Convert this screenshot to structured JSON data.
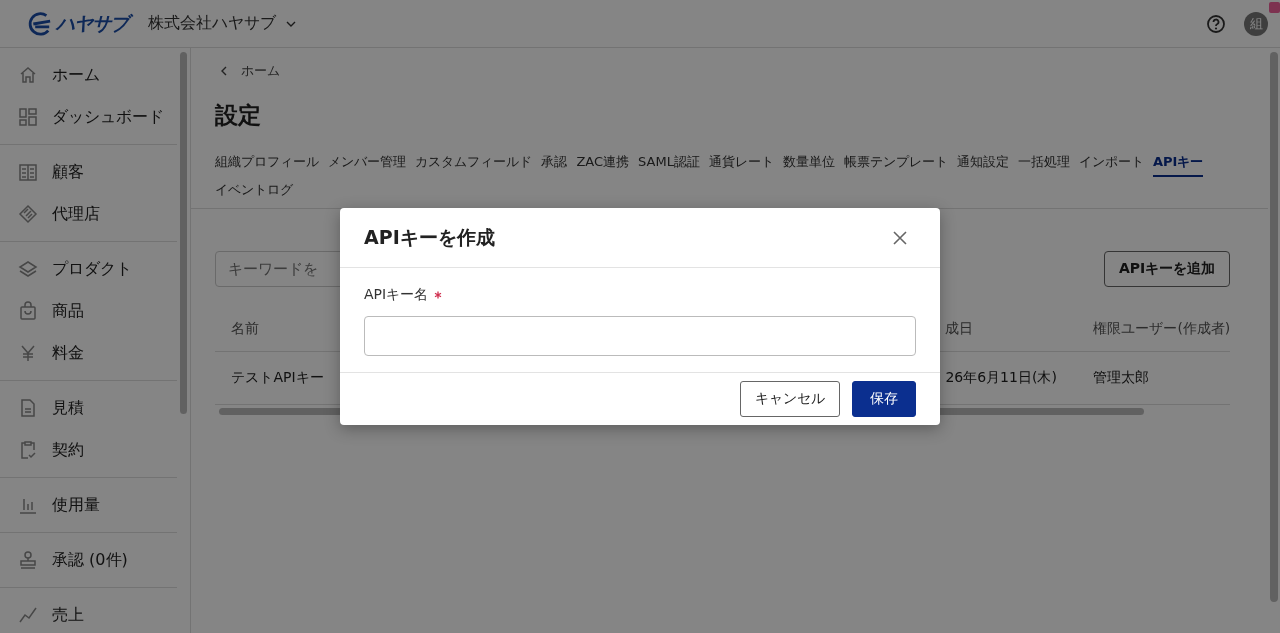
{
  "header": {
    "logo": "ハヤサブ",
    "company": "株式会社ハヤサブ",
    "avatar": "組"
  },
  "sidebar": {
    "groups": [
      {
        "items": [
          {
            "label": "ホーム"
          },
          {
            "label": "ダッシュボード"
          }
        ]
      },
      {
        "items": [
          {
            "label": "顧客"
          },
          {
            "label": "代理店"
          }
        ]
      },
      {
        "items": [
          {
            "label": "プロダクト"
          },
          {
            "label": "商品"
          },
          {
            "label": "料金"
          }
        ]
      },
      {
        "items": [
          {
            "label": "見積"
          },
          {
            "label": "契約"
          }
        ]
      },
      {
        "items": [
          {
            "label": "使用量"
          }
        ]
      },
      {
        "items": [
          {
            "label": "承認 (0件)"
          }
        ]
      },
      {
        "items": [
          {
            "label": "売上"
          }
        ]
      }
    ]
  },
  "breadcrumb": "ホーム",
  "title": "設定",
  "tabs": [
    {
      "label": "組織プロフィール",
      "selected": false
    },
    {
      "label": "メンバー管理",
      "selected": false
    },
    {
      "label": "カスタムフィールド",
      "selected": false
    },
    {
      "label": "承認",
      "selected": false
    },
    {
      "label": "ZAC連携",
      "selected": false
    },
    {
      "label": "SAML認証",
      "selected": false
    },
    {
      "label": "通貨レート",
      "selected": false
    },
    {
      "label": "数量単位",
      "selected": false
    },
    {
      "label": "帳票テンプレート",
      "selected": false
    },
    {
      "label": "通知設定",
      "selected": false
    },
    {
      "label": "一括処理",
      "selected": false
    },
    {
      "label": "インポート",
      "selected": false
    },
    {
      "label": "APIキー",
      "selected": true
    },
    {
      "label": "イベントログ",
      "selected": false
    }
  ],
  "search": {
    "placeholder": "キーワードを"
  },
  "add_button": "APIキーを追加",
  "table": {
    "columns": [
      "名前",
      "成日",
      "権限ユーザー(作成者)"
    ],
    "rows": [
      [
        "テストAPIキー",
        "26年6月11日(木)",
        "管理太郎"
      ]
    ]
  },
  "dialog": {
    "title": "APIキーを作成",
    "field": {
      "label": "APIキー名",
      "required": true
    },
    "buttons": [
      {
        "label": "キャンセル",
        "kind": "secondary"
      },
      {
        "label": "保存",
        "kind": "primary"
      }
    ]
  }
}
